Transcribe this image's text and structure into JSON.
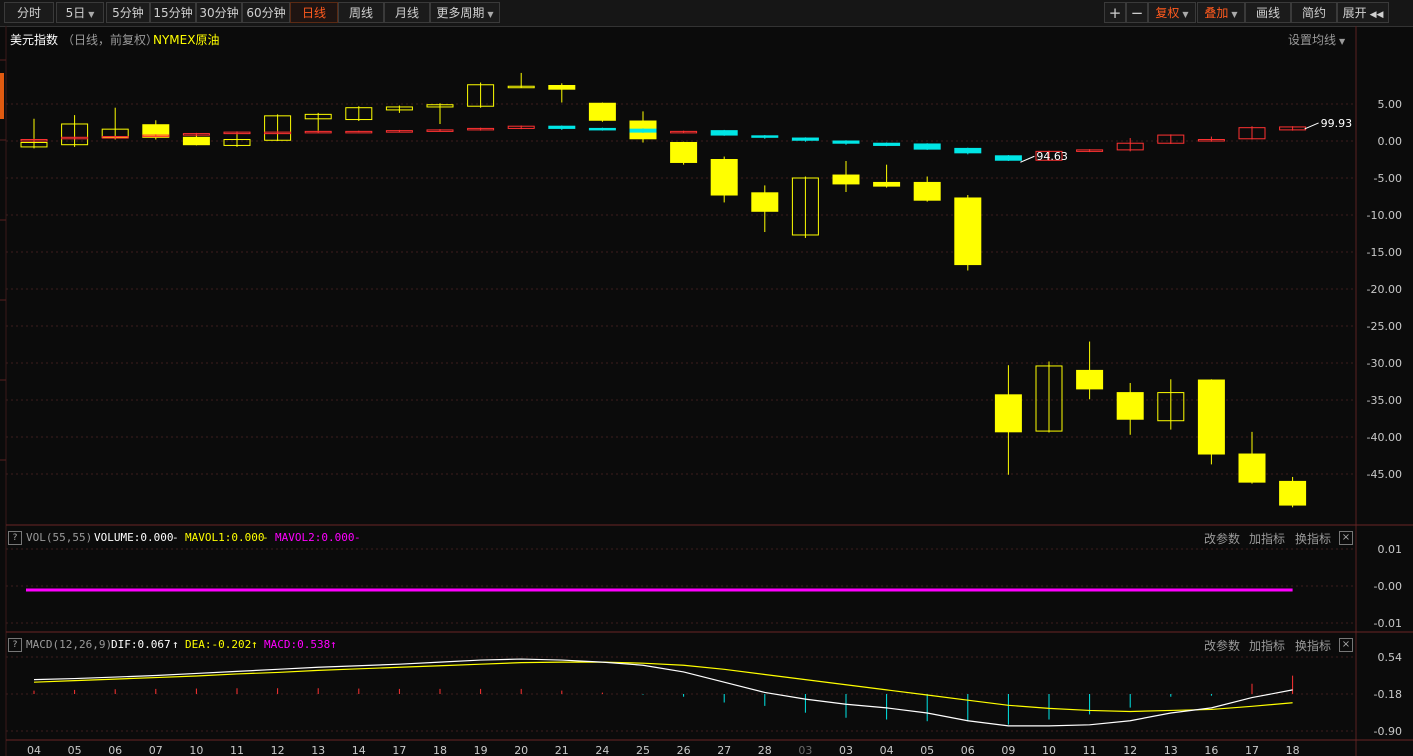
{
  "toolbar": {
    "periods": [
      "分时",
      "5日",
      "5分钟",
      "15分钟",
      "30分钟",
      "60分钟",
      "日线",
      "周线",
      "月线",
      "更多周期"
    ],
    "active": "日线",
    "right_buttons": {
      "plus": "+",
      "minus": "−",
      "fuquan": "复权",
      "diejia": "叠加",
      "huaxian": "画线",
      "jianyue": "简约",
      "zhankai": "展开"
    }
  },
  "header": {
    "name": "美元指数",
    "mode": "（日线，前复权）",
    "overlay": "NYMEX原油",
    "settings": "设置均线"
  },
  "colors": {
    "up": "#ff3232",
    "down": "#00e6e6",
    "overlay": "#ffff00",
    "grid": "#3c1e1e",
    "bg": "#0b0b0b",
    "magenta": "#ff00ff",
    "white": "#ffffff"
  },
  "vol_panel": {
    "help": "?",
    "title": "VOL(55,55)",
    "volume": "VOLUME:0.000",
    "mavol1": "MAVOL1:0.000",
    "mavol2": "MAVOL2:0.000",
    "dash": "-",
    "actions": [
      "改参数",
      "加指标",
      "换指标"
    ],
    "close": "×",
    "y_ticks": [
      "0.01",
      "-0.00",
      "-0.01"
    ]
  },
  "macd_panel": {
    "help": "?",
    "title": "MACD(12,26,9)",
    "dif": "DIF:0.067",
    "dea": "DEA:-0.202",
    "macd": "MACD:0.538",
    "arrow": "↑",
    "actions": [
      "改参数",
      "加指标",
      "换指标"
    ],
    "close": "×",
    "y_ticks": [
      "0.54",
      "-0.18",
      "-0.90"
    ]
  },
  "chart_data": {
    "type": "candlestick",
    "x_labels": [
      "04",
      "05",
      "06",
      "07",
      "10",
      "11",
      "12",
      "13",
      "14",
      "17",
      "18",
      "19",
      "20",
      "21",
      "24",
      "25",
      "26",
      "27",
      "28",
      "03",
      "03",
      "04",
      "05",
      "06",
      "09",
      "10",
      "11",
      "12",
      "13",
      "16",
      "17",
      "18"
    ],
    "dimmed_x_label_index": 19,
    "y_ticks": [
      "5.00",
      "0.00",
      "-5.00",
      "-10.00",
      "-15.00",
      "-20.00",
      "-25.00",
      "-30.00",
      "-35.00",
      "-40.00",
      "-45.00"
    ],
    "y_tick_values": [
      5,
      0,
      -5,
      -10,
      -15,
      -20,
      -25,
      -30,
      -35,
      -40,
      -45
    ],
    "y_range": [
      -49,
      10
    ],
    "series": [
      {
        "name": "美元指数",
        "hollow_up": true,
        "candles": [
          [
            0,
            0.2,
            0.3,
            -0.1
          ],
          [
            0.3,
            0.5,
            0.6,
            0.2
          ],
          [
            0.4,
            0.6,
            0.7,
            0.3
          ],
          [
            0.6,
            0.8,
            0.9,
            0.5
          ],
          [
            0.8,
            1.0,
            1.1,
            0.7
          ],
          [
            1.0,
            1.2,
            1.3,
            0.9
          ],
          [
            1.1,
            1.2,
            1.4,
            1.0
          ],
          [
            1.2,
            1.3,
            1.4,
            1.1
          ],
          [
            1.3,
            1.3,
            1.4,
            1.2
          ],
          [
            1.3,
            1.4,
            1.5,
            1.2
          ],
          [
            1.4,
            1.5,
            1.6,
            1.3
          ],
          [
            1.5,
            1.7,
            1.8,
            1.4
          ],
          [
            1.7,
            2.0,
            2.1,
            1.6
          ],
          [
            2.0,
            1.7,
            2.1,
            1.5
          ],
          [
            1.7,
            1.6,
            1.8,
            1.4
          ],
          [
            1.6,
            1.2,
            1.7,
            1.1
          ],
          [
            1.2,
            1.3,
            1.4,
            1.1
          ],
          [
            1.4,
            0.8,
            1.5,
            0.7
          ],
          [
            0.7,
            0.5,
            0.8,
            0.3
          ],
          [
            0.4,
            0.1,
            0.5,
            -0.1
          ],
          [
            0.0,
            -0.3,
            0.1,
            -0.5
          ],
          [
            -0.3,
            -0.6,
            -0.2,
            -0.7
          ],
          [
            -0.4,
            -1.1,
            -0.3,
            -1.2
          ],
          [
            -1.0,
            -1.6,
            -0.9,
            -1.8
          ],
          [
            -2.0,
            -2.6,
            -1.9,
            -2.7
          ],
          [
            -2.6,
            -1.4,
            -1.3,
            -2.7
          ],
          [
            -1.4,
            -1.2,
            -1.1,
            -1.5
          ],
          [
            -1.2,
            -0.3,
            0.4,
            -1.4
          ],
          [
            -0.3,
            0.8,
            0.9,
            -0.4
          ],
          [
            0.0,
            0.2,
            0.6,
            -0.1
          ],
          [
            0.3,
            1.8,
            2.0,
            0.2
          ],
          [
            1.5,
            1.9,
            2.0,
            1.4
          ]
        ]
      },
      {
        "name": "NYMEX原油",
        "hollow_up": true,
        "candles": [
          [
            -0.8,
            -0.2,
            3.0,
            -1.0
          ],
          [
            -0.5,
            2.3,
            3.5,
            -0.8
          ],
          [
            0.5,
            1.6,
            4.5,
            0.2
          ],
          [
            2.2,
            0.5,
            2.8,
            0.2
          ],
          [
            0.5,
            -0.5,
            0.9,
            -0.6
          ],
          [
            -0.6,
            0.2,
            1.0,
            -0.8
          ],
          [
            0.1,
            3.4,
            3.6,
            0.0
          ],
          [
            3.0,
            3.6,
            3.8,
            1.4
          ],
          [
            2.9,
            4.5,
            4.7,
            2.7
          ],
          [
            4.2,
            4.6,
            4.8,
            3.8
          ],
          [
            4.6,
            4.9,
            5.1,
            2.3
          ],
          [
            4.7,
            7.6,
            7.9,
            4.5
          ],
          [
            7.3,
            7.4,
            9.2,
            7.2
          ],
          [
            7.5,
            7.0,
            7.8,
            5.2
          ],
          [
            5.1,
            2.8,
            5.2,
            2.6
          ],
          [
            2.7,
            0.3,
            4.0,
            -0.2
          ],
          [
            -0.2,
            -2.9,
            -0.1,
            -3.2
          ],
          [
            -2.5,
            -7.3,
            -2.1,
            -8.3
          ],
          [
            -7.0,
            -9.5,
            -6.0,
            -12.3
          ],
          [
            -12.7,
            -5.0,
            -4.8,
            -13.1
          ],
          [
            -4.6,
            -5.8,
            -2.7,
            -6.9
          ],
          [
            -5.6,
            -6.1,
            -3.2,
            -6.3
          ],
          [
            -5.6,
            -8.0,
            -4.8,
            -8.2
          ],
          [
            -7.7,
            -16.7,
            -7.3,
            -17.5
          ],
          [
            -34.3,
            -39.3,
            -30.3,
            -45.1
          ],
          [
            -39.2,
            -30.4,
            -29.8,
            -39.4
          ],
          [
            -31.0,
            -33.5,
            -27.1,
            -34.9
          ],
          [
            -34.0,
            -37.6,
            -32.7,
            -39.7
          ],
          [
            -37.8,
            -34.0,
            -32.2,
            -39.0
          ],
          [
            -32.3,
            -42.3,
            -32.2,
            -43.7
          ],
          [
            -42.3,
            -46.1,
            -39.3,
            -46.3
          ],
          [
            -46.0,
            -49.2,
            -45.4,
            -49.5
          ]
        ]
      }
    ],
    "annotations": [
      {
        "text": "99.93",
        "at": [
          31,
          1.9
        ]
      },
      {
        "text": "94.63",
        "at": [
          24,
          -2.6
        ]
      }
    ],
    "volume": {
      "mavol_value": 0.0
    },
    "macd": {
      "y_range": [
        -0.9,
        0.54
      ],
      "dif": [
        0.1,
        0.12,
        0.15,
        0.18,
        0.22,
        0.26,
        0.3,
        0.34,
        0.37,
        0.4,
        0.44,
        0.48,
        0.5,
        0.48,
        0.44,
        0.38,
        0.25,
        0.05,
        -0.15,
        -0.28,
        -0.38,
        -0.45,
        -0.55,
        -0.7,
        -0.8,
        -0.8,
        -0.78,
        -0.7,
        -0.55,
        -0.45,
        -0.25,
        -0.1
      ],
      "dea": [
        0.05,
        0.08,
        0.11,
        0.14,
        0.17,
        0.21,
        0.24,
        0.28,
        0.31,
        0.34,
        0.37,
        0.4,
        0.43,
        0.44,
        0.44,
        0.42,
        0.38,
        0.3,
        0.2,
        0.1,
        0.0,
        -0.1,
        -0.2,
        -0.3,
        -0.4,
        -0.46,
        -0.5,
        -0.52,
        -0.5,
        -0.48,
        -0.42,
        -0.35
      ],
      "bars": [
        0.1,
        0.12,
        0.14,
        0.15,
        0.16,
        0.17,
        0.17,
        0.17,
        0.16,
        0.15,
        0.15,
        0.15,
        0.15,
        0.1,
        0.04,
        -0.02,
        -0.08,
        -0.25,
        -0.35,
        -0.55,
        -0.7,
        -0.75,
        -0.8,
        -0.8,
        -0.9,
        -0.75,
        -0.6,
        -0.4,
        -0.08,
        -0.05,
        0.3,
        0.54
      ]
    }
  }
}
